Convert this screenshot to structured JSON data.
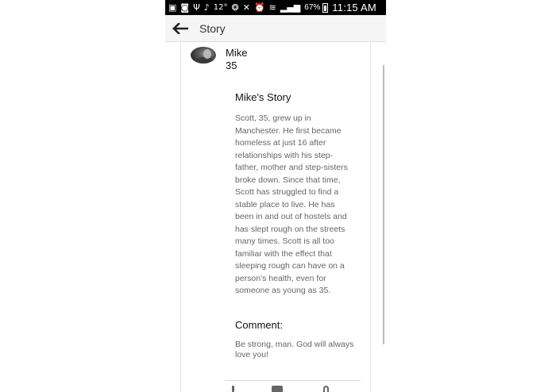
{
  "status_bar": {
    "icons": [
      "image-icon",
      "app-icon",
      "usb-icon",
      "notification-bell-icon"
    ],
    "temperature": "12°",
    "system_icons": [
      "color-wheel-icon",
      "mute-icon",
      "alarm-icon",
      "wifi-icon",
      "signal-icon"
    ],
    "battery": "67%",
    "time": "11:15 AM"
  },
  "app_bar": {
    "back_icon": "arrow-left-icon",
    "title": "Story"
  },
  "profile": {
    "name": "Mike",
    "age": "35"
  },
  "story": {
    "heading": "Mike's Story",
    "body": "Scott, 35, grew up in Manchester. He first became homeless at just 16 after relationships with his step-father, mother and step-sisters broke down. Since that time, Scott has struggled to find a stable place to live. He has been in and out of hostels and has slept rough on the streets many times. Scott is all too familiar with the effect that sleeping rough can have on a person's health, even for someone as young as 35."
  },
  "comment": {
    "label": "Comment:",
    "text": "Be strong, man. God will always love you!"
  },
  "actions": [
    "like-icon",
    "comment-icon",
    "share-icon"
  ]
}
